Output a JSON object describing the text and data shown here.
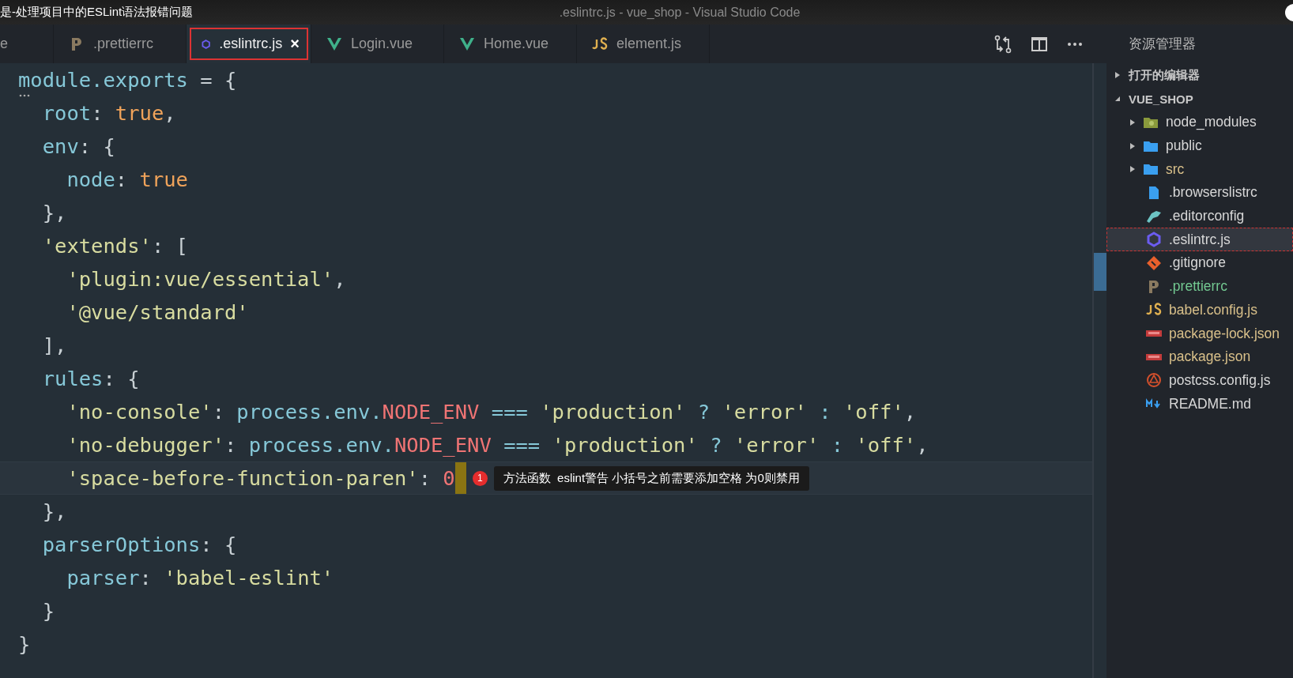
{
  "title_bar": {
    "caption": "是-处理项目中的ESLint语法报错问题",
    "title": ".eslintrc.js - vue_shop - Visual Studio Code"
  },
  "tabs": [
    {
      "label": "e",
      "kind": "none",
      "selected": false
    },
    {
      "label": ".prettierrc",
      "kind": "prettier",
      "selected": false
    },
    {
      "label": ".eslintrc.js",
      "kind": "eslint",
      "selected": true,
      "close": "×"
    },
    {
      "label": "Login.vue",
      "kind": "vue",
      "selected": false
    },
    {
      "label": "Home.vue",
      "kind": "vue",
      "selected": false
    },
    {
      "label": "element.js",
      "kind": "js",
      "selected": false
    }
  ],
  "editor": {
    "lines": [
      {
        "active": false,
        "tokens": [
          {
            "kind": "prop",
            "text": "module.exports"
          },
          {
            "kind": "punct",
            "text": " = {"
          }
        ]
      },
      {
        "active": false,
        "tokens": [
          {
            "kind": "prop",
            "text": "  root"
          },
          {
            "kind": "punct",
            "text": ": "
          },
          {
            "kind": "keyword",
            "text": "true"
          },
          {
            "kind": "punct",
            "text": ","
          }
        ]
      },
      {
        "active": false,
        "tokens": [
          {
            "kind": "prop",
            "text": "  env"
          },
          {
            "kind": "punct",
            "text": ": {"
          }
        ]
      },
      {
        "active": false,
        "tokens": [
          {
            "kind": "prop",
            "text": "    node"
          },
          {
            "kind": "punct",
            "text": ": "
          },
          {
            "kind": "keyword",
            "text": "true"
          }
        ]
      },
      {
        "active": false,
        "tokens": [
          {
            "kind": "punct",
            "text": "  },"
          }
        ]
      },
      {
        "active": false,
        "tokens": [
          {
            "kind": "string",
            "text": "  'extends'"
          },
          {
            "kind": "punct",
            "text": ": ["
          }
        ]
      },
      {
        "active": false,
        "tokens": [
          {
            "kind": "string",
            "text": "    'plugin:vue/essential'"
          },
          {
            "kind": "punct",
            "text": ","
          }
        ]
      },
      {
        "active": false,
        "tokens": [
          {
            "kind": "string",
            "text": "    '@vue/standard'"
          }
        ]
      },
      {
        "active": false,
        "tokens": [
          {
            "kind": "punct",
            "text": "  ],"
          }
        ]
      },
      {
        "active": false,
        "tokens": [
          {
            "kind": "prop",
            "text": "  rules"
          },
          {
            "kind": "punct",
            "text": ": {"
          }
        ]
      },
      {
        "active": false,
        "tokens": [
          {
            "kind": "string",
            "text": "    'no-console'"
          },
          {
            "kind": "punct",
            "text": ": "
          },
          {
            "kind": "prop",
            "text": "process.env."
          },
          {
            "kind": "const",
            "text": "NODE_ENV"
          },
          {
            "kind": "op",
            "text": " === "
          },
          {
            "kind": "string",
            "text": "'production'"
          },
          {
            "kind": "op",
            "text": " ? "
          },
          {
            "kind": "string",
            "text": "'error'"
          },
          {
            "kind": "op",
            "text": " : "
          },
          {
            "kind": "string",
            "text": "'off'"
          },
          {
            "kind": "punct",
            "text": ","
          }
        ]
      },
      {
        "active": false,
        "tokens": [
          {
            "kind": "string",
            "text": "    'no-debugger'"
          },
          {
            "kind": "punct",
            "text": ": "
          },
          {
            "kind": "prop",
            "text": "process.env."
          },
          {
            "kind": "const",
            "text": "NODE_ENV"
          },
          {
            "kind": "op",
            "text": " === "
          },
          {
            "kind": "string",
            "text": "'production'"
          },
          {
            "kind": "op",
            "text": " ? "
          },
          {
            "kind": "string",
            "text": "'error'"
          },
          {
            "kind": "op",
            "text": " : "
          },
          {
            "kind": "string",
            "text": "'off'"
          },
          {
            "kind": "punct",
            "text": ","
          }
        ]
      },
      {
        "active": true,
        "tokens": [
          {
            "kind": "string",
            "text": "    'space-before-function-paren'"
          },
          {
            "kind": "punct",
            "text": ": "
          },
          {
            "kind": "const",
            "text": "0"
          }
        ],
        "diagnostic": {
          "count": "1",
          "message": "方法函数  eslint警告 小括号之前需要添加空格 为0则禁用"
        }
      },
      {
        "active": false,
        "tokens": [
          {
            "kind": "punct",
            "text": "  },"
          }
        ]
      },
      {
        "active": false,
        "tokens": [
          {
            "kind": "prop",
            "text": "  parserOptions"
          },
          {
            "kind": "punct",
            "text": ": {"
          }
        ]
      },
      {
        "active": false,
        "tokens": [
          {
            "kind": "prop",
            "text": "    parser"
          },
          {
            "kind": "punct",
            "text": ": "
          },
          {
            "kind": "string",
            "text": "'babel-eslint'"
          }
        ]
      },
      {
        "active": false,
        "tokens": [
          {
            "kind": "punct",
            "text": "  }"
          }
        ]
      },
      {
        "active": false,
        "tokens": [
          {
            "kind": "punct",
            "text": "}"
          }
        ]
      }
    ]
  },
  "explorer": {
    "title": "资源管理器",
    "sections": [
      {
        "label": "打开的编辑器",
        "expanded": false
      },
      {
        "label": "VUE_SHOP",
        "expanded": true,
        "children": [
          {
            "name": "node_modules",
            "kind": "node-folder",
            "expanded": false,
            "selected": false,
            "color": "#d8d8d8"
          },
          {
            "name": "public",
            "kind": "folder",
            "expanded": false,
            "selected": false,
            "color": "#d8d8d8"
          },
          {
            "name": "src",
            "kind": "folder",
            "expanded": false,
            "selected": false,
            "color": "#d9c08a"
          },
          {
            "name": ".browserslistrc",
            "kind": "file",
            "selected": false,
            "color": "#d8d8d8"
          },
          {
            "name": ".editorconfig",
            "kind": "editorconfig",
            "selected": false,
            "color": "#d8d8d8"
          },
          {
            "name": ".eslintrc.js",
            "kind": "eslint",
            "selected": true,
            "color": "#d8d8d8"
          },
          {
            "name": ".gitignore",
            "kind": "git",
            "selected": false,
            "color": "#d8d8d8"
          },
          {
            "name": ".prettierrc",
            "kind": "prettier",
            "selected": false,
            "color": "#73c991"
          },
          {
            "name": "babel.config.js",
            "kind": "js",
            "selected": false,
            "color": "#d9c08a"
          },
          {
            "name": "package-lock.json",
            "kind": "npm",
            "selected": false,
            "color": "#d9c08a"
          },
          {
            "name": "package.json",
            "kind": "npm",
            "selected": false,
            "color": "#d9c08a"
          },
          {
            "name": "postcss.config.js",
            "kind": "postcss",
            "selected": false,
            "color": "#d8d8d8"
          },
          {
            "name": "README.md",
            "kind": "markdown",
            "selected": false,
            "color": "#d8d8d8"
          }
        ]
      }
    ]
  }
}
